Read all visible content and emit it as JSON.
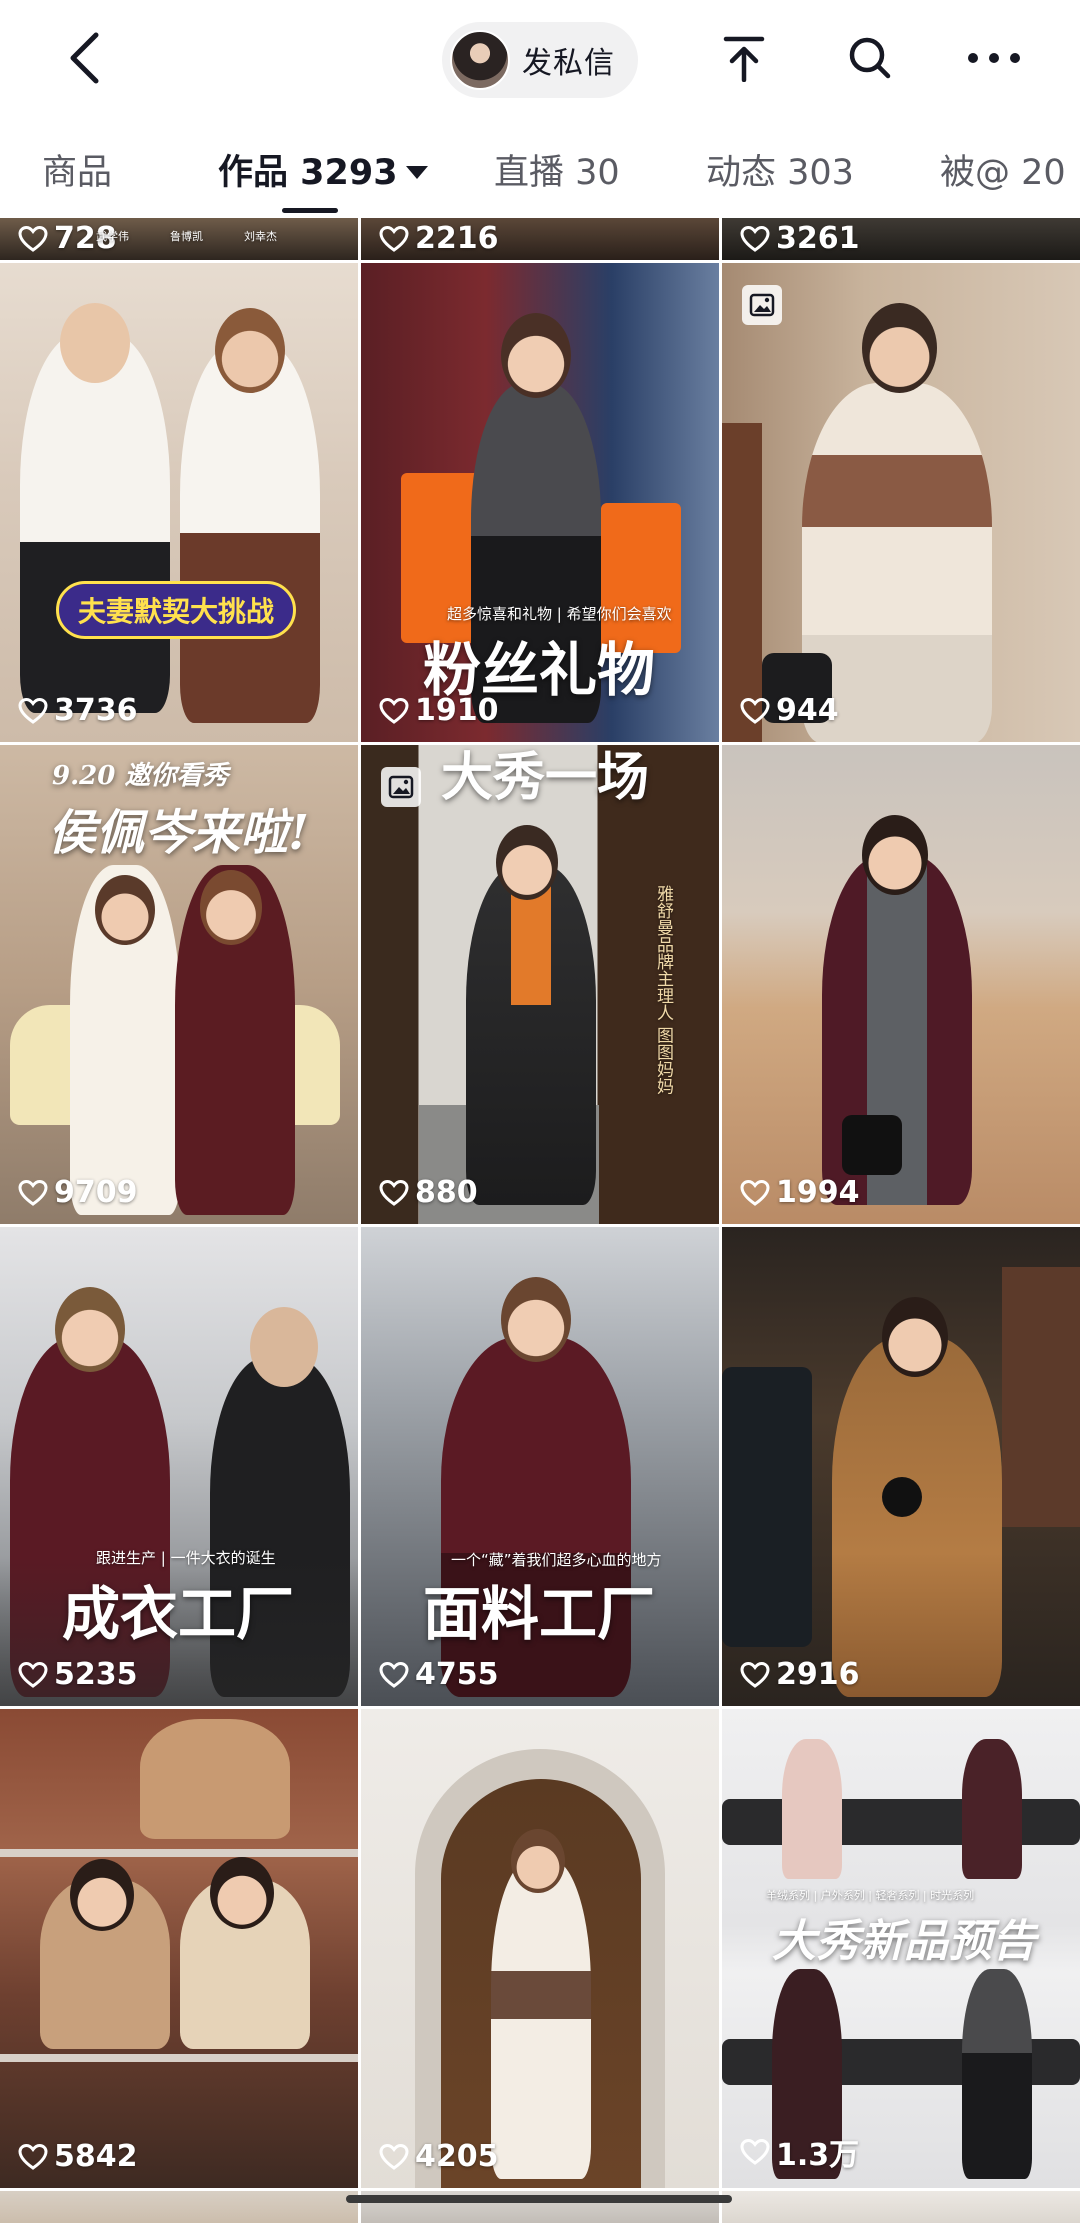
{
  "header": {
    "back_icon": "chevron-left-icon",
    "dm_label": "发私信",
    "top_icons": [
      "scroll-to-top-icon",
      "search-icon",
      "more-icon"
    ]
  },
  "tabs": [
    {
      "label": "商品"
    },
    {
      "label": "作品 3293",
      "active": true
    },
    {
      "label": "直播 30"
    },
    {
      "label": "动态 303"
    },
    {
      "label": "被@ 20"
    }
  ],
  "partial_row": {
    "likes": [
      "728",
      "2216",
      "3261"
    ],
    "captions": [
      "武学伟",
      "鲁博凯",
      "刘幸杰"
    ]
  },
  "grid": [
    {
      "likes": "3736",
      "badge": "夫妻默契大挑战",
      "photo_icon": false
    },
    {
      "likes": "1910",
      "subtitle": "超多惊喜和礼物 | 希望你们会喜欢",
      "title": "粉丝礼物",
      "photo_icon": false
    },
    {
      "likes": "944",
      "photo_icon": true
    },
    {
      "likes": "9709",
      "subtitle": "9.20 邀你看秀",
      "title": "侯佩岑来啦!",
      "photo_icon": false
    },
    {
      "likes": "880",
      "title": "大秀一场",
      "vertical": "雅舒曼品牌主理人 图图妈妈",
      "photo_icon": true
    },
    {
      "likes": "1994",
      "photo_icon": false
    },
    {
      "likes": "5235",
      "subtitle": "跟进生产 | 一件大衣的诞生",
      "title": "成衣工厂",
      "photo_icon": false
    },
    {
      "likes": "4755",
      "subtitle": "一个“藏”着我们超多心血的地方",
      "title": "面料工厂",
      "photo_icon": false
    },
    {
      "likes": "2916",
      "photo_icon": false
    },
    {
      "likes": "5842",
      "photo_icon": false
    },
    {
      "likes": "4205",
      "photo_icon": false
    },
    {
      "likes": "1.3万",
      "subtitle": "羊绒系列 | 户外系列 | 轻奢系列 | 时光系列",
      "title": "大秀新品预告",
      "photo_icon": false
    }
  ],
  "colors": {
    "text_primary": "#161823",
    "text_secondary": "#5a5b63",
    "pill_bg": "#f1f1f2"
  }
}
